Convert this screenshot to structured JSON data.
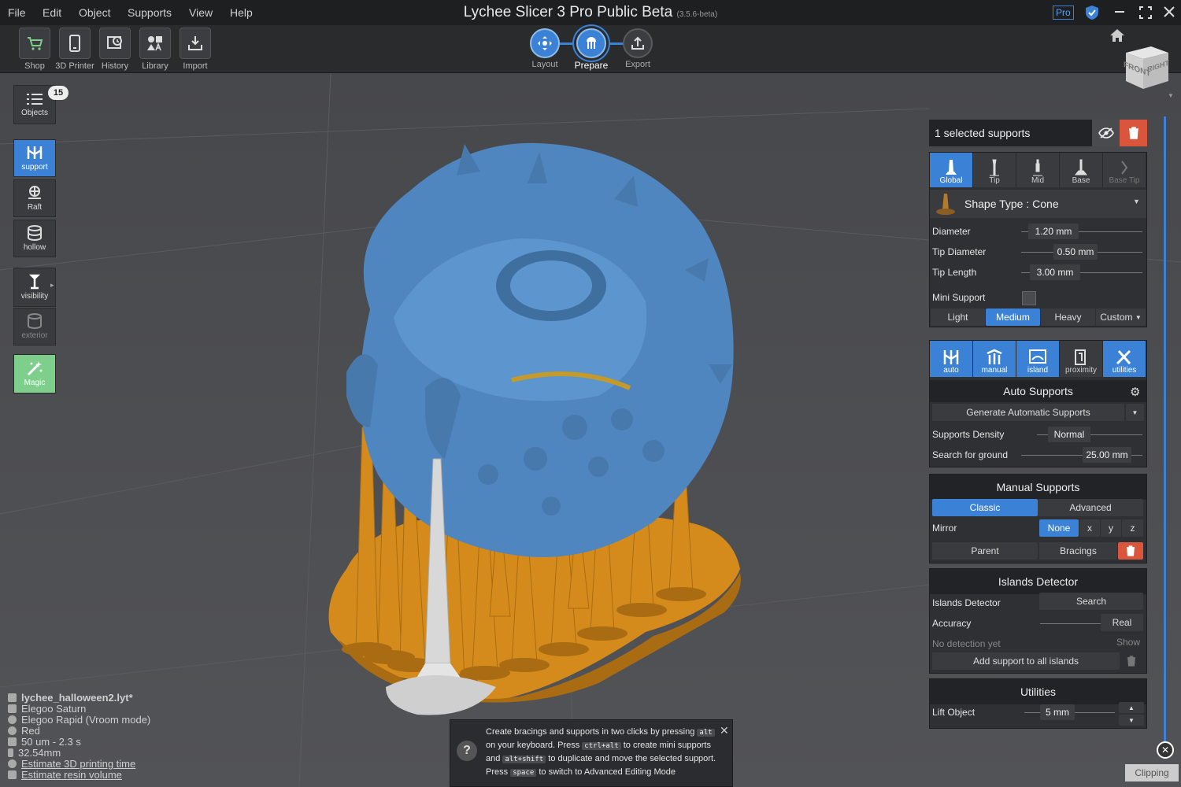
{
  "app": {
    "title": "Lychee Slicer 3 Pro Public Beta",
    "version": "(3.5.6-beta)",
    "badge": "Pro"
  },
  "menu": [
    "File",
    "Edit",
    "Object",
    "Supports",
    "View",
    "Help"
  ],
  "toolbar": {
    "left": [
      {
        "label": "Shop",
        "icon": "cart-icon"
      },
      {
        "label": "3D Printer",
        "icon": "phone-icon"
      },
      {
        "label": "History",
        "icon": "history-icon"
      },
      {
        "label": "Library",
        "icon": "library-icon"
      },
      {
        "label": "Import",
        "icon": "import-icon"
      }
    ],
    "steps": [
      {
        "label": "Layout",
        "icon": "move-icon",
        "active": false
      },
      {
        "label": "Prepare",
        "icon": "support-icon",
        "active": true
      },
      {
        "label": "Export",
        "icon": "export-icon",
        "active": false
      }
    ]
  },
  "left_tools": {
    "objects": {
      "label": "Objects",
      "count": "15"
    },
    "support": "support",
    "raft": "Raft",
    "hollow": "hollow",
    "visibility": "visibility",
    "exterior": "exterior",
    "magic": "Magic"
  },
  "selection": {
    "label": "1 selected supports"
  },
  "support_tabs": [
    "Global",
    "Tip",
    "Mid",
    "Base",
    "Base Tip"
  ],
  "shape": {
    "label": "Shape Type : Cone"
  },
  "params": [
    {
      "label": "Diameter",
      "value": "1.20 mm"
    },
    {
      "label": "Tip Diameter",
      "value": "0.50 mm"
    },
    {
      "label": "Tip Length",
      "value": "3.00 mm"
    }
  ],
  "mini_support": {
    "label": "Mini Support"
  },
  "presets": {
    "light": "Light",
    "medium": "Medium",
    "heavy": "Heavy",
    "custom": "Custom"
  },
  "mode_tabs": [
    "auto",
    "manual",
    "island",
    "proximity",
    "utilities"
  ],
  "auto": {
    "title": "Auto Supports",
    "generate": "Generate Automatic Supports",
    "density_label": "Supports Density",
    "density_value": "Normal",
    "ground_label": "Search for ground",
    "ground_value": "25.00 mm"
  },
  "manual": {
    "title": "Manual Supports",
    "classic": "Classic",
    "advanced": "Advanced",
    "mirror_label": "Mirror",
    "none": "None",
    "x": "x",
    "y": "y",
    "z": "z",
    "parent": "Parent",
    "bracings": "Bracings"
  },
  "islands": {
    "title": "Islands Detector",
    "detector_label": "Islands Detector",
    "search": "Search",
    "accuracy_label": "Accuracy",
    "accuracy_value": "Real",
    "status": "No detection yet",
    "show": "Show",
    "add_all": "Add support to all islands"
  },
  "utilities": {
    "title": "Utilities",
    "lift_label": "Lift Object",
    "lift_value": "5 mm"
  },
  "clipping": "Clipping",
  "info": [
    {
      "text": "lychee_halloween2.lyt*",
      "bold": true
    },
    {
      "text": "Elegoo Saturn"
    },
    {
      "text": "Elegoo Rapid (Vroom mode)"
    },
    {
      "text": "Red"
    },
    {
      "text": "50 um - 2.3 s"
    },
    {
      "text": "32.54mm"
    },
    {
      "text": "Estimate 3D printing time",
      "link": true
    },
    {
      "text": "Estimate resin volume",
      "link": true
    }
  ],
  "tip": {
    "t1": "Create bracings and supports in two clicks by pressing",
    "k1": "alt",
    "t2": "on your keyboard. Press",
    "k2": "ctrl+alt",
    "t3": "to create mini supports",
    "t4": "and",
    "k3": "alt+shift",
    "t5": "to duplicate and move the selected support.",
    "t6": "Press",
    "k4": "space",
    "t7": "to switch to Advanced Editing Mode"
  },
  "viewcube": {
    "front": "FRONT",
    "right": "RIGHT"
  },
  "colors": {
    "accent": "#3b82d6",
    "model": "#4f86bf",
    "support": "#d48b1c",
    "selected": "#d8d8d8",
    "danger": "#d9553b",
    "magic": "#7fcf8c"
  }
}
